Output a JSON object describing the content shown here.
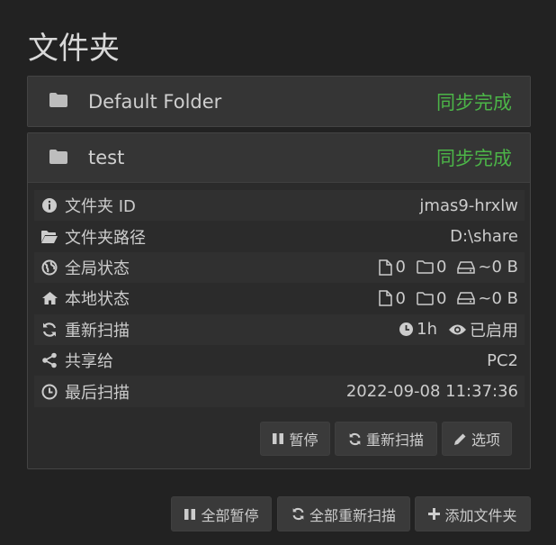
{
  "page": {
    "title": "文件夹"
  },
  "folders": [
    {
      "name": "Default Folder",
      "status": "同步完成"
    },
    {
      "name": "test",
      "status": "同步完成"
    }
  ],
  "details": {
    "folder_id": {
      "label": "文件夹 ID",
      "value": "jmas9-hrxlw"
    },
    "folder_path": {
      "label": "文件夹路径",
      "value": "D:\\share"
    },
    "global_state": {
      "label": "全局状态",
      "files": "0",
      "dirs": "0",
      "size": "~0 B"
    },
    "local_state": {
      "label": "本地状态",
      "files": "0",
      "dirs": "0",
      "size": "~0 B"
    },
    "rescan": {
      "label": "重新扫描",
      "interval": "1h",
      "watch": "已启用"
    },
    "shared_with": {
      "label": "共享给",
      "value": "PC2"
    },
    "last_scan": {
      "label": "最后扫描",
      "value": "2022-09-08 11:37:36"
    }
  },
  "folder_actions": {
    "pause": "暂停",
    "rescan": "重新扫描",
    "options": "选项"
  },
  "global_actions": {
    "pause_all": "全部暂停",
    "rescan_all": "全部重新扫描",
    "add_folder": "添加文件夹"
  },
  "colors": {
    "background": "#222222",
    "panel": "#2b2b2b",
    "heading": "#353535",
    "status_ok": "#4cb548"
  }
}
